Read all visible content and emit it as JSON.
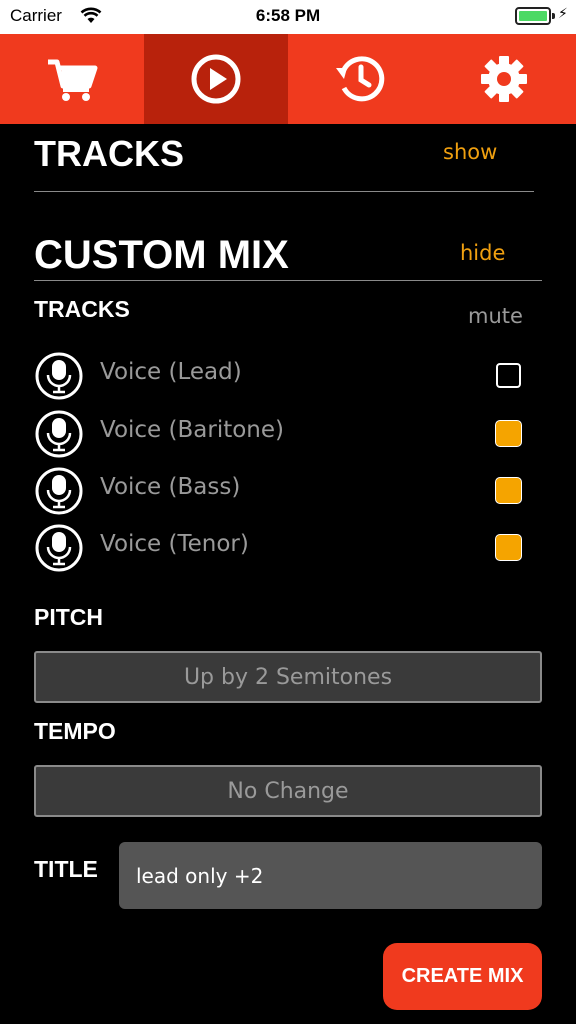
{
  "status_bar": {
    "carrier": "Carrier",
    "time": "6:58 PM"
  },
  "tabbar": {
    "tabs": [
      {
        "icon": "shopping-cart-icon",
        "active": false
      },
      {
        "icon": "play-icon",
        "active": true
      },
      {
        "icon": "history-icon",
        "active": false
      },
      {
        "icon": "gear-icon",
        "active": false
      }
    ]
  },
  "tracks_section": {
    "title": "TRACKS",
    "toggle": "show"
  },
  "custom_mix": {
    "title": "CUSTOM MIX",
    "toggle": "hide",
    "tracks_heading": "TRACKS",
    "mute_label": "mute",
    "tracks": [
      {
        "label": "Voice (Lead)",
        "muted": false
      },
      {
        "label": "Voice (Baritone)",
        "muted": true
      },
      {
        "label": "Voice (Bass)",
        "muted": true
      },
      {
        "label": "Voice (Tenor)",
        "muted": true
      }
    ],
    "pitch_heading": "PITCH",
    "pitch_value": "Up by 2 Semitones",
    "tempo_heading": "TEMPO",
    "tempo_value": "No Change",
    "title_label": "TITLE",
    "title_value": "lead only +2",
    "create_button": "CREATE MIX"
  },
  "colors": {
    "accent": "#f03a1e",
    "accent_dark": "#b8220c",
    "link": "#f0a010",
    "checkbox": "#f5a400"
  }
}
